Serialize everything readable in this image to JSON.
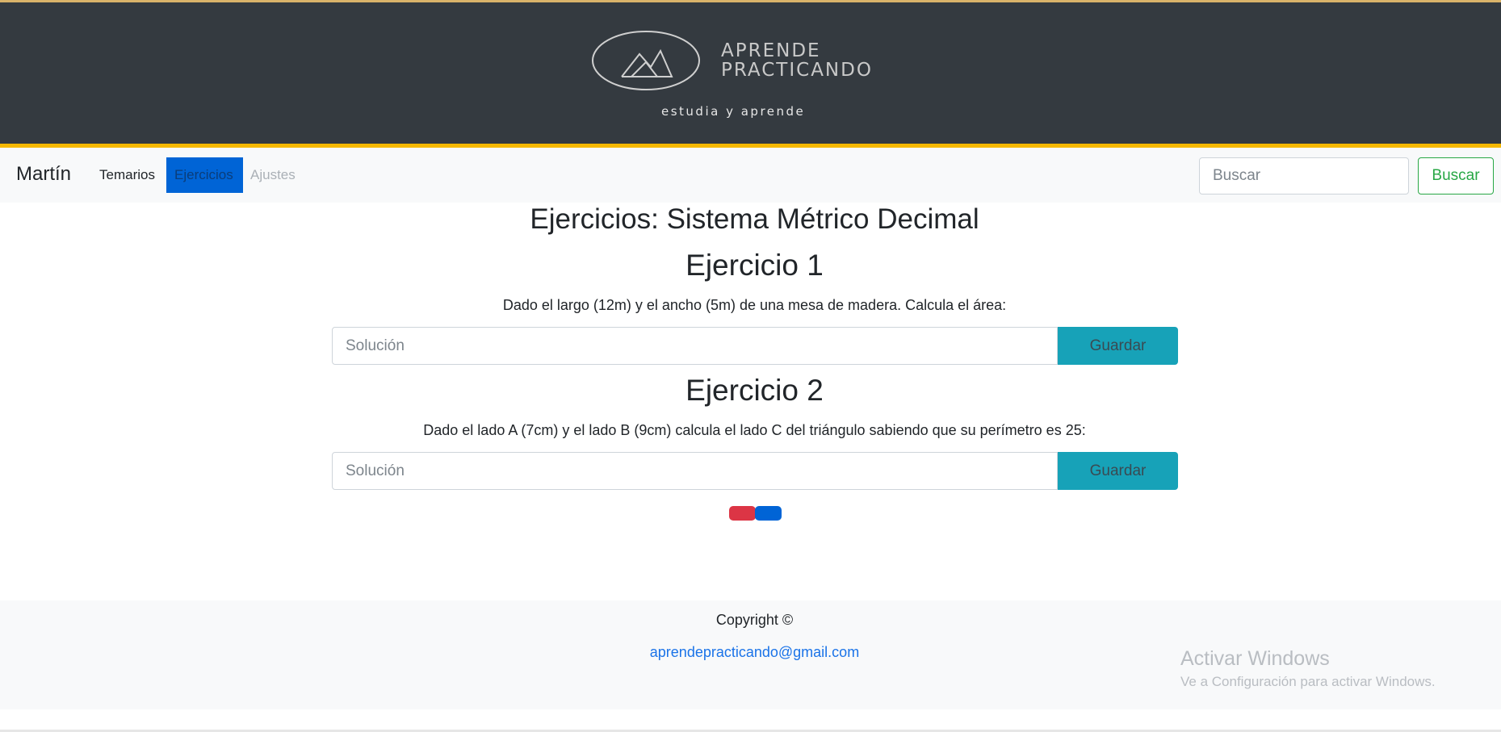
{
  "header": {
    "logo_line1": "APRENDE",
    "logo_line2": "PRACTICANDO",
    "tagline": "estudia y aprende"
  },
  "navbar": {
    "brand": "Martín",
    "items": [
      {
        "label": "Temarios",
        "state": "normal"
      },
      {
        "label": "Ejercicios",
        "state": "active"
      },
      {
        "label": "Ajustes",
        "state": "disabled"
      }
    ],
    "search_placeholder": "Buscar",
    "search_button": "Buscar"
  },
  "main": {
    "title": "Ejercicios: Sistema Métrico Decimal",
    "exercises": [
      {
        "title": "Ejercicio 1",
        "text": "Dado el largo (12m) y el ancho (5m) de una mesa de madera. Calcula el área:",
        "placeholder": "Solución",
        "button": "Guardar"
      },
      {
        "title": "Ejercicio 2",
        "text": "Dado el lado A (7cm) y el lado B (9cm) calcula el lado C del triángulo sabiendo que su perímetro es 25:",
        "placeholder": "Solución",
        "button": "Guardar"
      }
    ]
  },
  "footer": {
    "copyright": "Copyright ©",
    "email": "aprendepracticando@gmail.com"
  },
  "windows_watermark": {
    "title": "Activar Windows",
    "subtitle": "Ve a Configuración para activar Windows."
  },
  "colors": {
    "banner_bg": "#343a40",
    "banner_accent": "#f5b800",
    "active_nav": "#0064d6",
    "search_green": "#28a745",
    "save_button": "#17a2b8",
    "pager_red": "#dc3545",
    "pager_blue": "#0064d6"
  }
}
